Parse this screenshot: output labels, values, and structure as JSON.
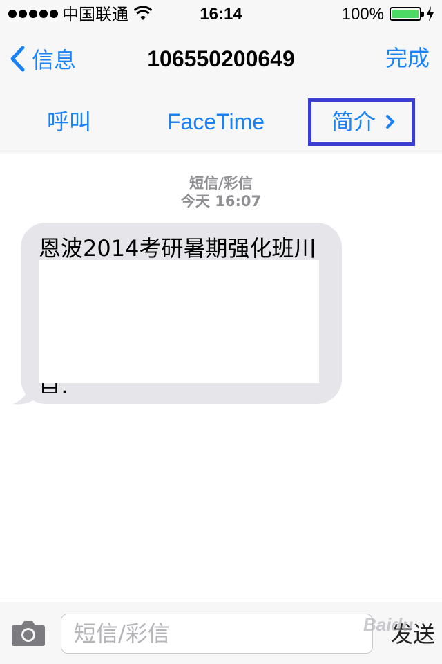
{
  "status_bar": {
    "carrier": "中国联通",
    "time": "16:14",
    "battery_percent": "100%",
    "battery_level": 1.0,
    "battery_color": "#4cd964"
  },
  "nav": {
    "back_label": "信息",
    "title": "106550200649",
    "done_label": "完成"
  },
  "actions": {
    "call": "呼叫",
    "facetime": "FaceTime",
    "info": "简介",
    "highlight_color": "#3b3fd1"
  },
  "conversation": {
    "type_label": "短信/彩信",
    "timestamp": "今天 16:07",
    "message_first_line": "恩波2014考研暑期强化班川",
    "message_tail": "目,"
  },
  "input_bar": {
    "placeholder": "短信/彩信",
    "send_label": "发送",
    "watermark": "Baidu"
  },
  "colors": {
    "accent": "#1a82f7",
    "bubble": "#e5e5ea"
  }
}
